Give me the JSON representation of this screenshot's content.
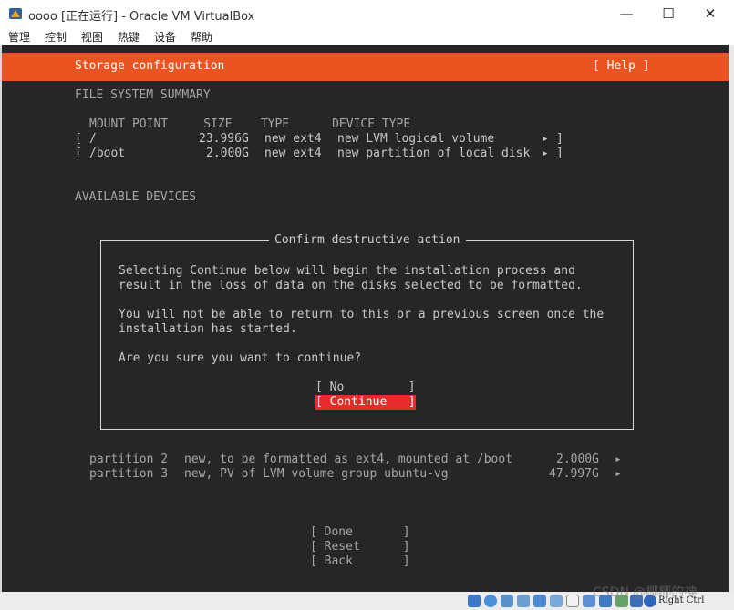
{
  "window": {
    "title": "oooo [正在运行] - Oracle VM VirtualBox",
    "minimize": "—",
    "maximize": "☐",
    "close": "✕"
  },
  "menu": [
    "管理",
    "控制",
    "视图",
    "热键",
    "设备",
    "帮助"
  ],
  "installer": {
    "header_title": "Storage configuration",
    "help": "[ Help ]",
    "fs_summary_heading": "FILE SYSTEM SUMMARY",
    "fs_columns": "MOUNT POINT     SIZE    TYPE      DEVICE TYPE",
    "fs_rows": [
      {
        "bracket_open": "[",
        "mount": "/",
        "size": "23.996G",
        "type": "new ext4",
        "device": "new LVM logical volume",
        "arrow": "▸",
        "bracket_close": "]"
      },
      {
        "bracket_open": "[",
        "mount": "/boot",
        "size": "2.000G",
        "type": "new ext4",
        "device": "new partition of local disk",
        "arrow": "▸",
        "bracket_close": "]"
      }
    ],
    "available_heading": "AVAILABLE DEVICES",
    "partitions": [
      {
        "name": "partition 2",
        "desc": "new, to be formatted as ext4, mounted at /boot",
        "size": "2.000G",
        "arrow": "▸"
      },
      {
        "name": "partition 3",
        "desc": "new, PV of LVM volume group ubuntu-vg",
        "size": "47.997G",
        "arrow": "▸"
      }
    ],
    "actions": [
      "[ Done       ]",
      "[ Reset      ]",
      "[ Back       ]"
    ]
  },
  "dialog": {
    "title": "Confirm destructive action",
    "line1": "Selecting Continue below will begin the installation process and",
    "line2": "result in the loss of data on the disks selected to be formatted.",
    "line3": "You will not be able to return to this or a previous screen once the",
    "line4": "installation has started.",
    "question": "Are you sure you want to continue?",
    "no_button": "[ No         ]",
    "continue_button": "[ Continue   ]"
  },
  "statusbar": {
    "host_key": "Right Ctrl"
  },
  "watermark": "CSDN @椰椰的神",
  "colors": {
    "accent": "#e95420",
    "selected_button": "#e62b2b",
    "terminal_bg": "#262626"
  }
}
